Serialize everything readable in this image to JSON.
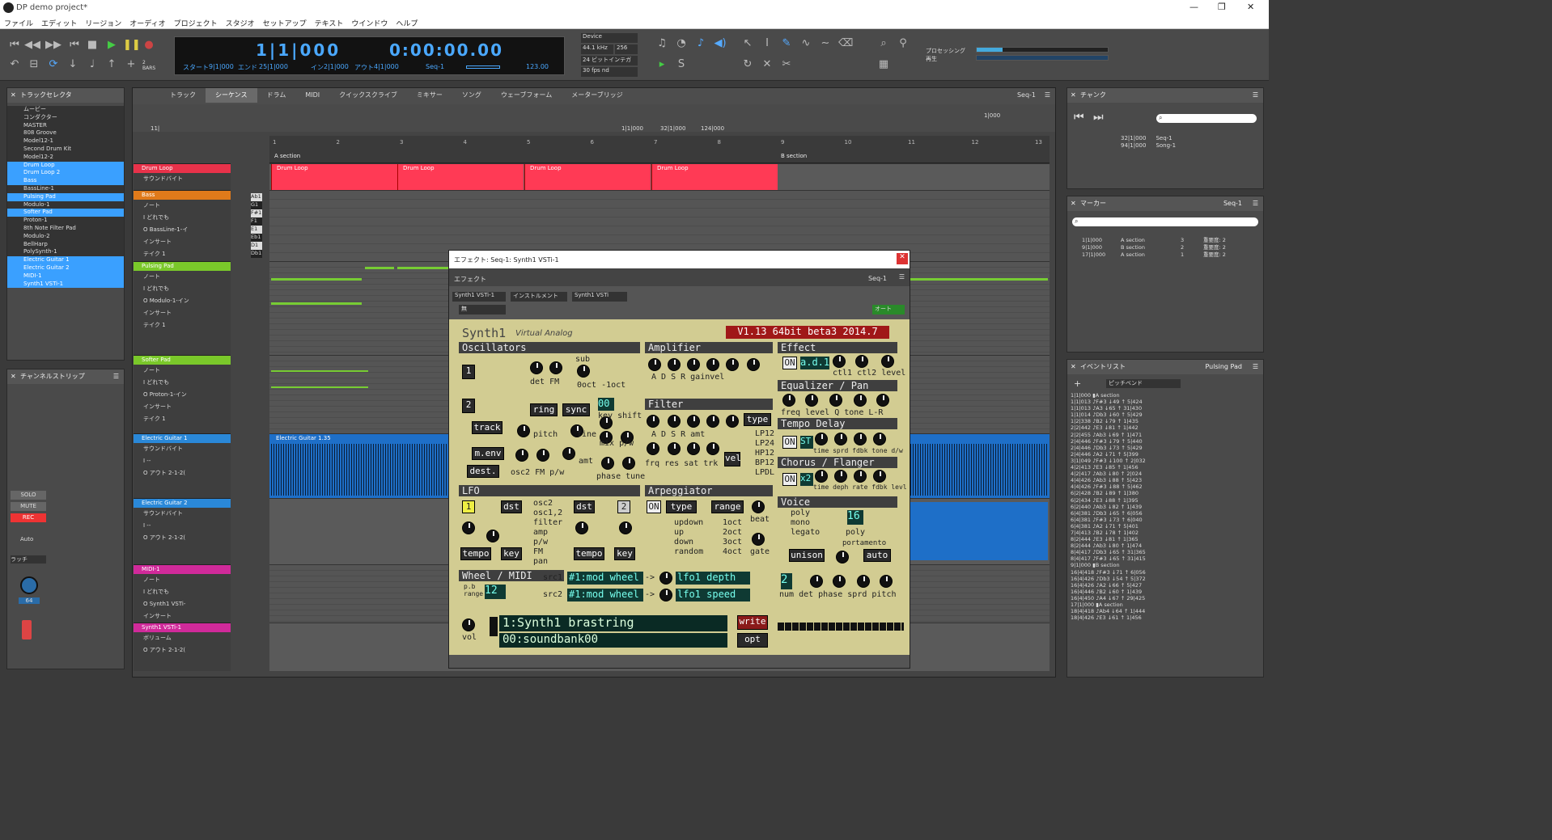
{
  "window": {
    "title": "DP demo project*",
    "controls": [
      "—",
      "❐",
      "✕"
    ]
  },
  "menu": [
    "ファイル",
    "エディット",
    "リージョン",
    "オーディオ",
    "プロジェクト",
    "スタジオ",
    "セットアップ",
    "テキスト",
    "ウインドウ",
    "ヘルプ"
  ],
  "transport": {
    "bars": "1|1|000",
    "time": "0:00:00.00",
    "start_label": "スタート",
    "start": "9|1|000",
    "end_label": "エンド",
    "end": "25|1|000",
    "in_label": "イン",
    "in": "2|1|000",
    "out_label": "アウト",
    "out": "4|1|000",
    "seq": "Seq-1",
    "tempo": "123.00",
    "bars_label": "2 BARS"
  },
  "device": {
    "label": "Device",
    "rate": "44.1 kHz",
    "buffer": "256",
    "bits": "24 ビットインテガ",
    "fps": "30 fps nd"
  },
  "processing": {
    "label": "プロセッシング",
    "play": "再生"
  },
  "track_selector": {
    "title": "トラックセレクタ",
    "items": [
      {
        "name": "ムービー",
        "sel": false
      },
      {
        "name": "コンダクター",
        "sel": false
      },
      {
        "name": "MASTER",
        "sel": false
      },
      {
        "name": "808 Groove",
        "sel": false
      },
      {
        "name": "Model12-1",
        "sel": false
      },
      {
        "name": "Second Drum Kit",
        "sel": false
      },
      {
        "name": "Model12-2",
        "sel": false
      },
      {
        "name": "Drum Loop",
        "sel": true
      },
      {
        "name": "Drum Loop 2",
        "sel": true
      },
      {
        "name": "Bass",
        "sel": true
      },
      {
        "name": "BassLine-1",
        "sel": false
      },
      {
        "name": "Pulsing Pad",
        "sel": true
      },
      {
        "name": "Modulo-1",
        "sel": false
      },
      {
        "name": "Softer Pad",
        "sel": true
      },
      {
        "name": "Proton-1",
        "sel": false
      },
      {
        "name": "8th Note Filter Pad",
        "sel": false
      },
      {
        "name": "Modulo-2",
        "sel": false
      },
      {
        "name": "BellHarp",
        "sel": false
      },
      {
        "name": "PolySynth-1",
        "sel": false
      },
      {
        "name": "Electric Guitar 1",
        "sel": true
      },
      {
        "name": "Electric Guitar 2",
        "sel": true
      },
      {
        "name": "MIDI-1",
        "sel": true
      },
      {
        "name": "Synth1 VSTi-1",
        "sel": true
      }
    ]
  },
  "channel_strip": {
    "title": "チャンネルストリップ",
    "solo": "SOLO",
    "mute": "MUTE",
    "rec": "REC",
    "auto": "Auto",
    "latch": "ラッチ",
    "value": "64"
  },
  "tabs": [
    "トラック",
    "シーケンス",
    "ドラム",
    "MIDI",
    "クイックスクライブ",
    "ミキサー",
    "ソング",
    "ウェーブフォーム",
    "メーターブリッジ"
  ],
  "active_tab": "シーケンス",
  "seq_selector": "Seq-1",
  "seq_bar": {
    "start": "1|1|000",
    "end": "32|1|000",
    "len": "124|000",
    "snap": "1|000",
    "edit": "11|"
  },
  "ruler": [
    "1",
    "2",
    "3",
    "4",
    "5",
    "6",
    "7",
    "8",
    "9",
    "10",
    "11",
    "12",
    "13"
  ],
  "markers": {
    "a": "A section",
    "b": "B section"
  },
  "tracks": [
    {
      "name": "Drum Loop",
      "color": "#e8324a",
      "rows": [
        "サウンドバイト"
      ]
    },
    {
      "name": "Bass",
      "color": "#e07a1a",
      "rows": [
        "ノート",
        "I どれでも",
        "O BassLine-1-イ",
        "インサート",
        "テイク 1"
      ]
    },
    {
      "name": "Pulsing Pad",
      "color": "#7ac82a",
      "rows": [
        "ノート",
        "I どれでも",
        "O Modulo-1-イン",
        "インサート",
        "テイク 1"
      ]
    },
    {
      "name": "Softer Pad",
      "color": "#7ac82a",
      "rows": [
        "ノート",
        "I どれでも",
        "O Proton-1-イン",
        "インサート",
        "テイク 1"
      ]
    },
    {
      "name": "Electric Guitar 1",
      "color": "#2a88d8",
      "rows": [
        "サウンドバイト",
        "I --",
        "O アウト 2-1-2("
      ]
    },
    {
      "name": "Electric Guitar 2",
      "color": "#2a88d8",
      "rows": [
        "サウンドバイト",
        "I --",
        "O アウト 2-1-2("
      ]
    },
    {
      "name": "MIDI-1",
      "color": "#d02a9a",
      "rows": [
        "ノート",
        "I どれでも",
        "O Synth1 VSTi-",
        "インサート"
      ]
    },
    {
      "name": "Synth1 VSTi-1",
      "color": "#d02a9a",
      "rows": [
        "ボリューム",
        "O アウト 2-1-2("
      ]
    }
  ],
  "pitch_labels": [
    "Ab1",
    "G1",
    "F#1",
    "F1",
    "E1",
    "Eb1",
    "D1",
    "Db1"
  ],
  "drum_clip": "Drum Loop",
  "guitar_clip": "Electric Guitar 1.35",
  "plugin": {
    "title": "エフェクト: Seq-1: Synth1 VSTi-1",
    "effect_label": "エフェクト",
    "seq": "Seq-1",
    "instance": "Synth1 VSTi-1",
    "instrument": "インストルメント",
    "name": "Synth1 VSTi",
    "preset": "無",
    "auto": "オート"
  },
  "synth": {
    "title": "Synth1",
    "subtitle": "Virtual Analog",
    "version": "V1.13 64bit beta3 2014.7",
    "sections": {
      "osc": "Oscillators",
      "amp": "Amplifier",
      "effect": "Effect",
      "eq": "Equalizer / Pan",
      "filter": "Filter",
      "delay": "Tempo Delay",
      "chorus": "Chorus / Flanger",
      "lfo": "LFO",
      "arp": "Arpeggiator",
      "voice": "Voice",
      "wheel": "Wheel / MIDI"
    },
    "patch": "1:Synth1 brastring",
    "bank": "00:soundbank00",
    "write": "write",
    "opt": "opt",
    "vol": "vol",
    "src1": "#1:mod wheel",
    "dst1": "lfo1 depth",
    "src2": "#1:mod wheel",
    "dst2": "lfo1 speed",
    "pb_range": "12",
    "poly": "16",
    "unison_num": "2",
    "effect_type": "a.d.1",
    "delay_type": "ST",
    "chorus_type": "x2"
  },
  "chunks": {
    "title": "チャンク",
    "rows": [
      {
        "ep": "32|1|000",
        "name": "Seq-1"
      },
      {
        "ep": "94|1|000",
        "name": "Song-1"
      }
    ]
  },
  "markers_panel": {
    "title": "マーカー",
    "seq": "Seq-1",
    "rows": [
      {
        "t": "1|1|000",
        "n": "A section",
        "num": "3",
        "w": "重要度: 2"
      },
      {
        "t": "9|1|000",
        "n": "B section",
        "num": "2",
        "w": "重要度: 2"
      },
      {
        "t": "17|1|000",
        "n": "A section",
        "num": "1",
        "w": "重要度: 2"
      }
    ]
  },
  "events": {
    "title": "イベントリスト",
    "track": "Pulsing Pad",
    "filter": "ピッチベンド",
    "rows": [
      "1|1|000 ▮A section",
      "1|1|013 ♪F#3 ↓49 ↑ 5|424",
      "1|1|013 ♪A3 ↓65 ↑ 31|430",
      "1|1|014 ♪Db3 ↓60 ↑ 5|429",
      "1|2|338 ♪B2 ↓79 ↑ 1|435",
      "2|2|442 ♪E3 ↓81 ↑ 1|442",
      "2|2|455 ♪Ab3 ↓69 ↑ 1|471",
      "2|4|446 ♪F#3 ↓79 ↑ 5|440",
      "2|4|446 ♪Db3 ↓73 ↑ 5|429",
      "2|4|446 ♪A2 ↓71 ↑ 5|399",
      "3|1|049 ♪F#3 ↓100 ↑ 2|032",
      "4|2|413 ♪E3 ↓85 ↑ 1|456",
      "4|2|417 ♪Ab3 ↓80 ↑ 2|024",
      "4|4|426 ♪Ab3 ↓88 ↑ 5|423",
      "4|4|426 ♪F#3 ↓88 ↑ 5|462",
      "6|2|428 ♪B2 ↓89 ↑ 1|380",
      "6|2|434 ♪E3 ↓88 ↑ 1|395",
      "6|2|440 ♪Ab3 ↓82 ↑ 1|439",
      "6|4|381 ♪Db3 ↓65 ↑ 6|056",
      "6|4|381 ♪F#3 ↓73 ↑ 6|040",
      "6|4|381 ♪A2 ↓71 ↑ 5|401",
      "7|4|413 ♪B2 ↓78 ↑ 1|402",
      "8|2|444 ♪E3 ↓81 ↑ 1|365",
      "8|2|444 ♪Ab3 ↓80 ↑ 1|474",
      "8|4|417 ♪Db3 ↓65 ↑ 31|365",
      "8|4|417 ♪F#3 ↓65 ↑ 31|415",
      "9|1|000 ▮B section",
      "16|4|418 ♪F#3 ↓71 ↑ 6|056",
      "16|4|426 ♪Db3 ↓54 ↑ 5|372",
      "16|4|426 ♪A2 ↓66 ↑ 5|427",
      "16|4|446 ♪B2 ↓60 ↑ 1|439",
      "16|4|450 ♪A4 ↓67 ↑ 29|425",
      "17|1|000 ▮A section",
      "18|4|418 ♪Ab4 ↓64 ↑ 1|444",
      "18|4|426 ♪E3 ↓61 ↑ 1|456"
    ]
  }
}
